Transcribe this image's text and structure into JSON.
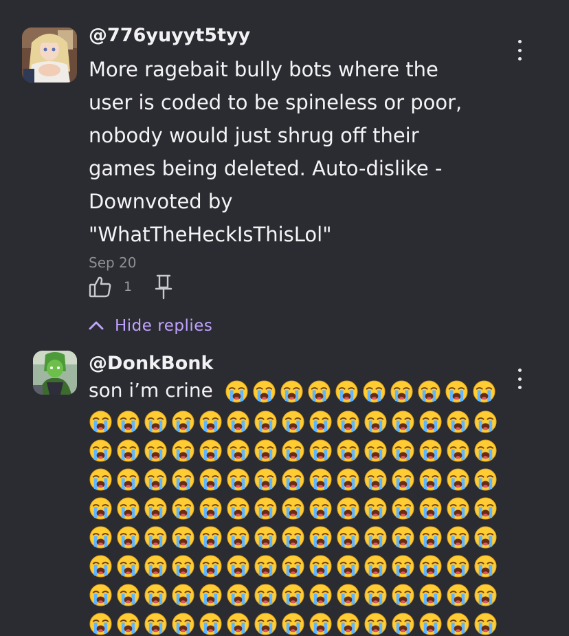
{
  "comments": [
    {
      "username": "@776yuyyt5tyy",
      "text": "More ragebait bully bots where the user is coded to be spineless or poor, nobody would just shrug off their games being deleted. Auto-dislike - Downvoted by \"WhatTheHeckIsThisLol\"",
      "lines": [
        "More ragebait bully bots where the",
        "user is coded to be spineless or poor,",
        "nobody would just shrug off their",
        "games being deleted. Auto-dislike -",
        "Downvoted by",
        "\"WhatTheHeckIsThisLol\""
      ],
      "date": "Sep 20",
      "likes": "1",
      "avatar_icon": "anime-avatar",
      "menu_icon": "more-vertical-icon"
    }
  ],
  "replies_toggle": {
    "label": "Hide replies",
    "icon": "chevron-up-icon",
    "color": "#c0a3ff"
  },
  "reply": {
    "username": "@DonkBonk",
    "text_prefix": "son i’m crine",
    "emoji": "😭",
    "emoji_name": "loudly-crying-face",
    "first_line_emoji_count": 10,
    "rows": 8,
    "per_row": 15,
    "avatar_icon": "green-character-avatar",
    "menu_icon": "more-vertical-icon"
  },
  "colors": {
    "background": "#2b2c31",
    "text": "#f2f2f4",
    "muted": "#8d8e96",
    "accent": "#c0a3ff"
  }
}
